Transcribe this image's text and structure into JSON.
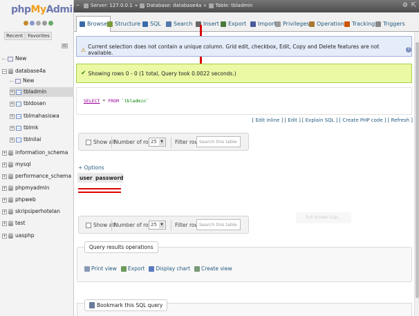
{
  "logo": {
    "php": "php",
    "my": "My",
    "admin": "Admin"
  },
  "nav_tabs": [
    "Recent",
    "Favorites"
  ],
  "tree": [
    {
      "label": "New",
      "type": "new",
      "indent": 0
    },
    {
      "label": "database4a",
      "type": "db",
      "indent": 0
    },
    {
      "label": "New",
      "type": "new",
      "indent": 1
    },
    {
      "label": "tbladmin",
      "type": "tbl",
      "indent": 1,
      "selected": true
    },
    {
      "label": "tbldosen",
      "type": "tbl",
      "indent": 1
    },
    {
      "label": "tblmahasiswa",
      "type": "tbl",
      "indent": 1
    },
    {
      "label": "tblmk",
      "type": "tbl",
      "indent": 1
    },
    {
      "label": "tblnilai",
      "type": "tbl",
      "indent": 1
    },
    {
      "label": "information_schema",
      "type": "db",
      "indent": 0
    },
    {
      "label": "mysql",
      "type": "db",
      "indent": 0
    },
    {
      "label": "performance_schema",
      "type": "db",
      "indent": 0
    },
    {
      "label": "phpmyadmin",
      "type": "db",
      "indent": 0
    },
    {
      "label": "phpweb",
      "type": "db",
      "indent": 0
    },
    {
      "label": "skripsiperhotelan",
      "type": "db",
      "indent": 0
    },
    {
      "label": "test",
      "type": "db",
      "indent": 0
    },
    {
      "label": "uasphp",
      "type": "db",
      "indent": 0
    }
  ],
  "breadcrumb": {
    "server": "Server: 127.0.0.1",
    "database": "Database: database4a",
    "table": "Table: tbladmin"
  },
  "tabs": [
    {
      "label": "Browse",
      "active": true,
      "color": "#3b6aa8"
    },
    {
      "label": "Structure",
      "color": "#7a9a3a"
    },
    {
      "label": "SQL",
      "color": "#3b6aa8"
    },
    {
      "label": "Search",
      "color": "#5577aa"
    },
    {
      "label": "Insert",
      "color": "#666666"
    },
    {
      "label": "Export",
      "color": "#4a7a3a"
    },
    {
      "label": "Import",
      "color": "#4a5a9a"
    },
    {
      "label": "Privileges",
      "color": "#999999"
    },
    {
      "label": "Operations",
      "color": "#aa7733"
    },
    {
      "label": "Tracking",
      "color": "#cc5500"
    },
    {
      "label": "Triggers",
      "color": "#888888"
    }
  ],
  "warning": "Current selection does not contain a unique column. Grid edit, checkbox, Edit, Copy and Delete features are not available.",
  "success": "Showing rows 0 - 0 (1 total, Query took 0.0022 seconds.)",
  "sql": {
    "select": "SELECT",
    "star": " * ",
    "from": "FROM",
    "table": " `tbladmin`"
  },
  "sql_links": [
    "[ Edit inline ]",
    "[ Edit ]",
    "[ Explain SQL ]",
    "[ Create PHP code ]",
    "[ Refresh ]"
  ],
  "navbar": {
    "show_all": "Show all",
    "number_of_rows": "Number of rows:",
    "rows_value": "25",
    "filter_rows": "Filter rows:",
    "filter_placeholder": "Search this table"
  },
  "options_link": "+ Options",
  "columns": [
    "user",
    "password"
  ],
  "filter_hint": "Full screen Sup...",
  "query_results_operations": {
    "legend": "Query results operations",
    "links": [
      "Print view",
      "Export",
      "Display chart",
      "Create view"
    ]
  },
  "bookmark": "Bookmark this SQL query"
}
